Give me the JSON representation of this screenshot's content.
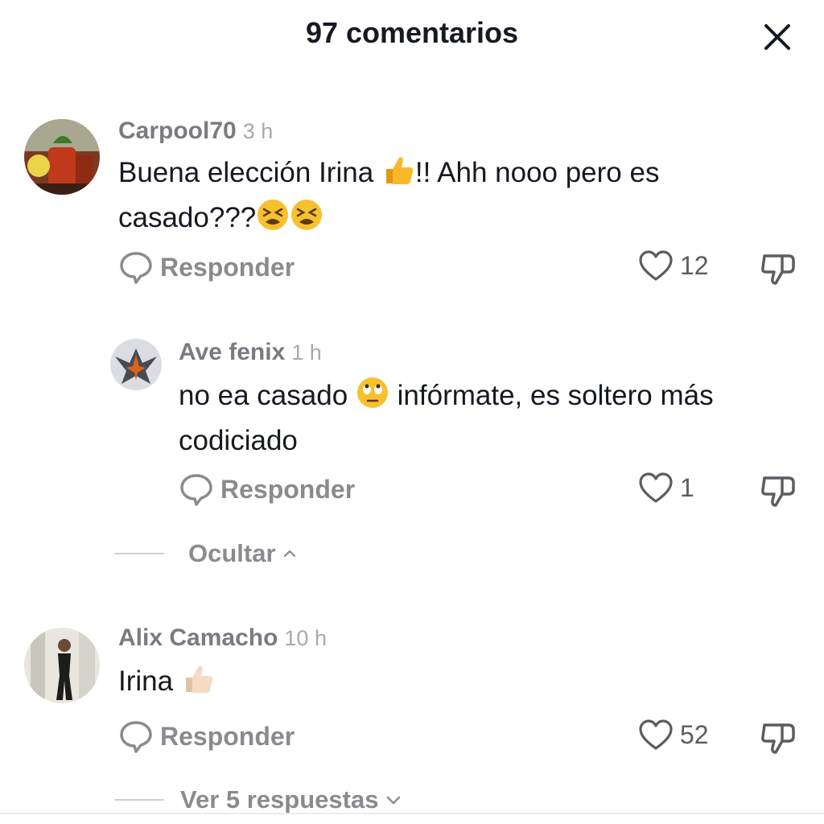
{
  "header": {
    "title": "97 comentarios"
  },
  "comments": [
    {
      "username": "Carpool70",
      "time": "3 h",
      "text_line1": "Buena elección Irina",
      "text_line1_after": "!! Ahh nooo pero es",
      "text_line2": "casado???",
      "reply_label": "Responder",
      "likes": "12",
      "avatar_icon": "drinks-photo-avatar"
    },
    {
      "username": "Ave fenix",
      "time": "1 h",
      "text_line1_before": "no ea casado",
      "text_line1_after": "infórmate, es soltero más",
      "text_line2": "codiciado",
      "reply_label": "Responder",
      "likes": "1",
      "avatar_icon": "phoenix-avatar"
    },
    {
      "username": "Alix Camacho",
      "time": "10 h",
      "text_line1": "Irina",
      "reply_label": "Responder",
      "likes": "52",
      "avatar_icon": "person-photo-avatar"
    }
  ],
  "thread": {
    "hide_label": "Ocultar",
    "view_replies_label": "Ver 5 respuestas"
  },
  "colors": {
    "text": "#161823",
    "muted": "#8a8b91",
    "emoji_yellow": "#f7b928"
  }
}
